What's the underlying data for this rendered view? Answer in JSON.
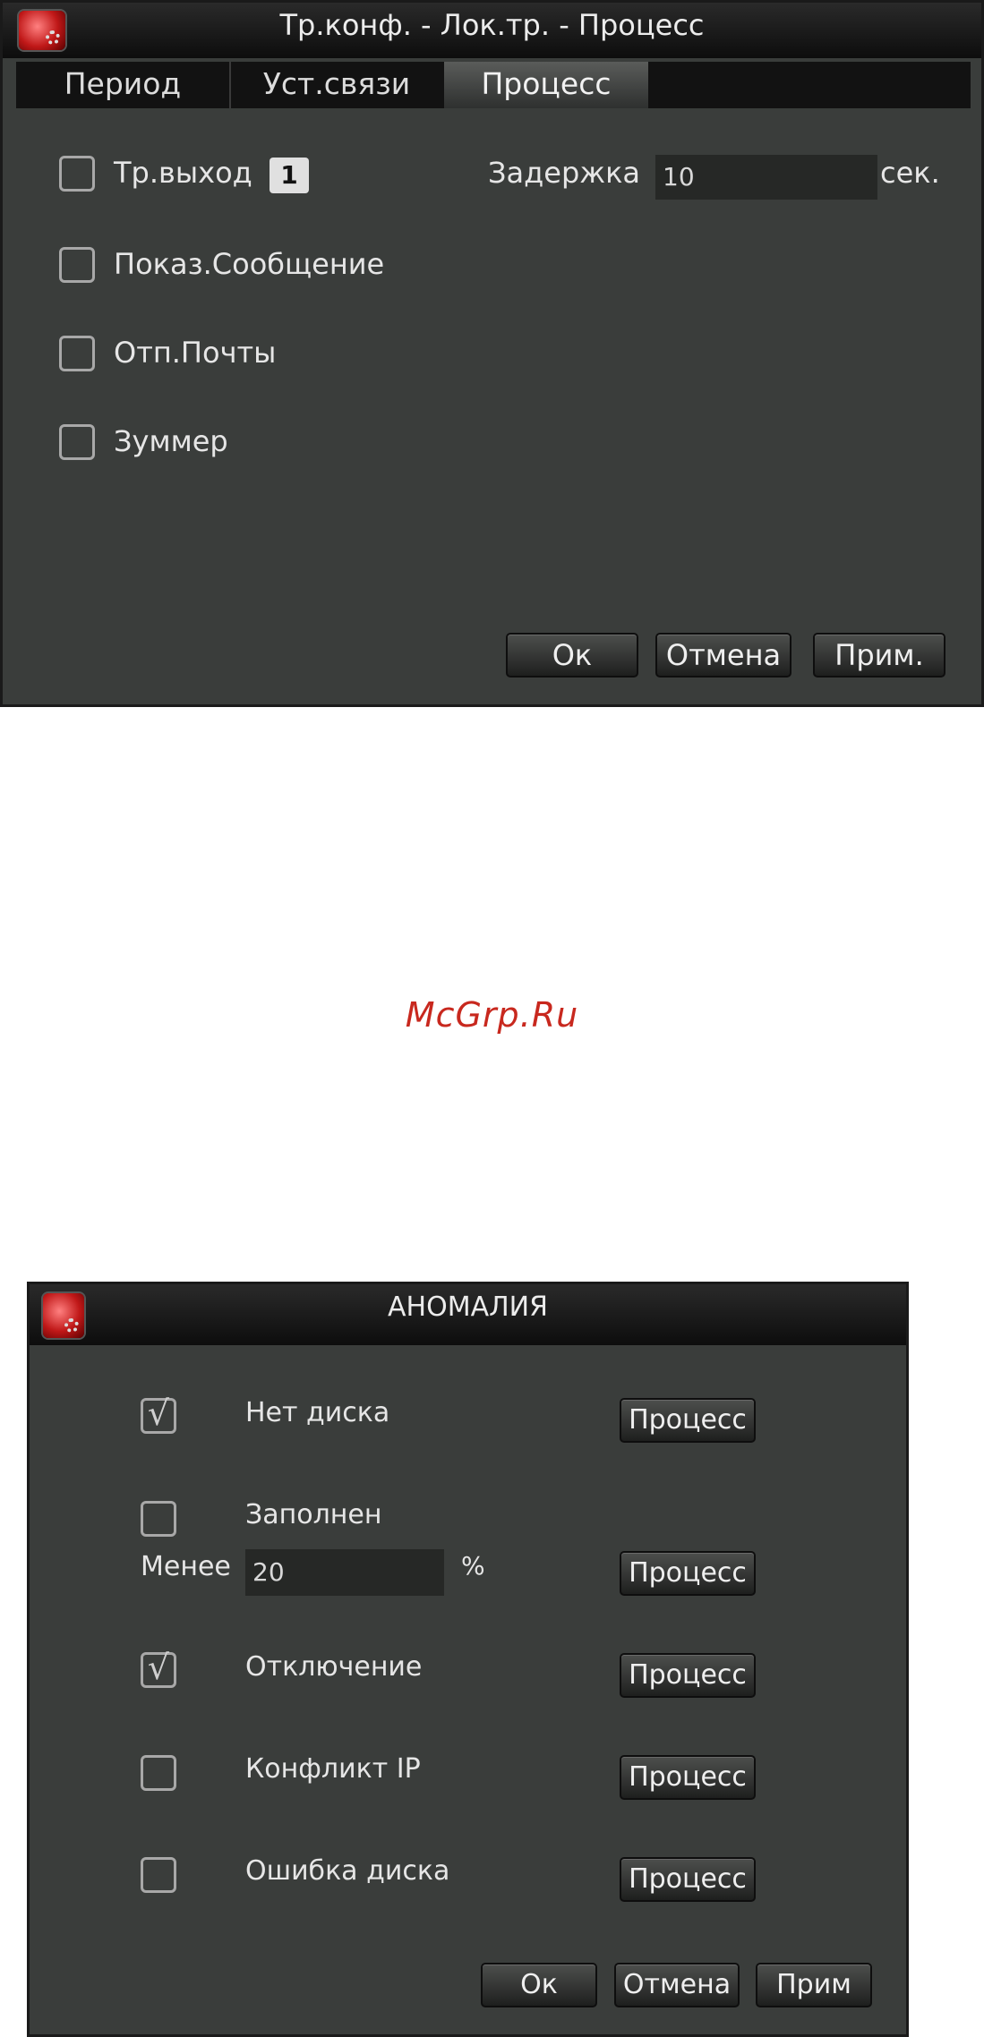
{
  "dialog1": {
    "title": "Тр.конф. - Лок.тр. - Процесс",
    "tabs": [
      {
        "label": "Период"
      },
      {
        "label": "Уст.связи"
      },
      {
        "label": "Процесс"
      }
    ],
    "active_tab": "Процесс",
    "options": {
      "alarm_out": {
        "label": "Тр.выход",
        "channel": "1",
        "checked": false
      },
      "delay": {
        "label": "Задержка",
        "value": "10",
        "unit": "сек."
      },
      "show_message": {
        "label": "Показ.Сообщение",
        "checked": false
      },
      "send_email": {
        "label": "Отп.Почты",
        "checked": false
      },
      "buzzer": {
        "label": "Зуммер",
        "checked": false
      }
    },
    "buttons": {
      "ok": "Ок",
      "cancel": "Отмена",
      "apply": "Прим."
    }
  },
  "watermark": "McGrp.Ru",
  "dialog2": {
    "title": "АНОМАЛИЯ",
    "rows": {
      "no_disk": {
        "label": "Нет диска",
        "checked": true,
        "process": "Процесс"
      },
      "disk_full": {
        "label": "Заполнен",
        "checked": false,
        "less_label": "Менее",
        "less_value": "20",
        "unit": "%",
        "process": "Процесс"
      },
      "disconnect": {
        "label": "Отключение",
        "checked": true,
        "process": "Процесс"
      },
      "ip_conflict": {
        "label": "Конфликт IP",
        "checked": false,
        "process": "Процесс"
      },
      "disk_error": {
        "label": "Ошибка диска",
        "checked": false,
        "process": "Процесс"
      }
    },
    "check_mark": "√",
    "buttons": {
      "ok": "Ок",
      "cancel": "Отмена",
      "apply": "Прим"
    }
  },
  "colors": {
    "panel": "#3a3d3b",
    "titlebar": "#111111",
    "text": "#e6e6e6",
    "watermark": "#c8281e"
  }
}
